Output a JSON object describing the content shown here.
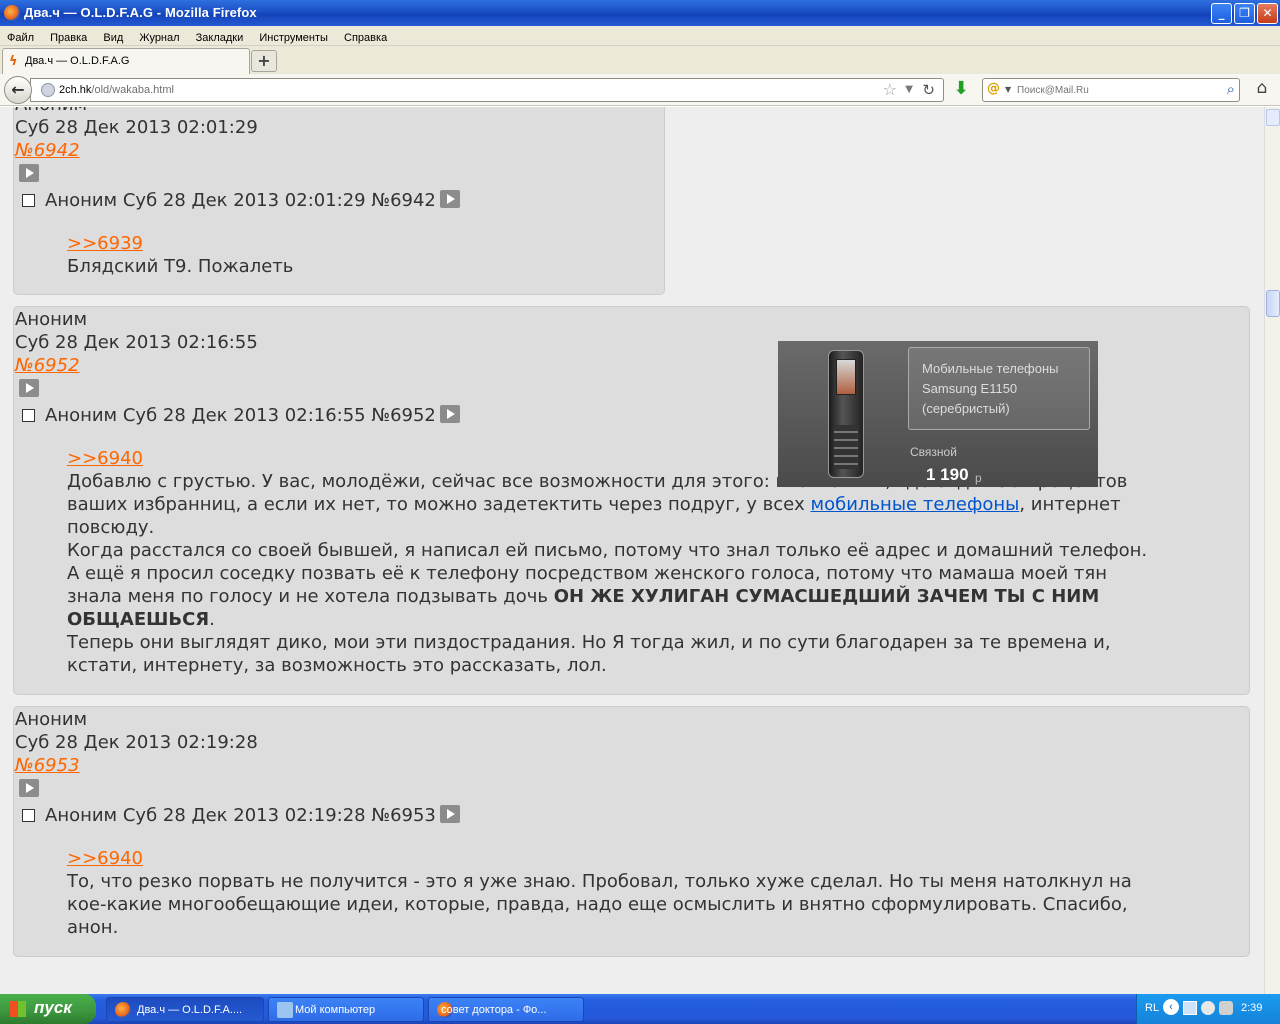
{
  "window": {
    "title": "Два.ч — O.L.D.F.A.G - Mozilla Firefox",
    "minimize_label": "_",
    "maximize_label": "❐",
    "close_label": "✕"
  },
  "menu": [
    "Файл",
    "Правка",
    "Вид",
    "Журнал",
    "Закладки",
    "Инструменты",
    "Справка"
  ],
  "tabs": [
    {
      "label": "Два.ч — O.L.D.F.A.G"
    }
  ],
  "new_tab_label": "+",
  "address": {
    "host": "2ch.hk",
    "path": "/old/wakaba.html"
  },
  "search": {
    "placeholder": "Поиск@Mail.Ru"
  },
  "colors": {
    "link_orange": "#ff6600",
    "post_bg": "#dddddd",
    "page_bg": "#eeeeee",
    "link_blue": "#0055cc"
  },
  "posts": [
    {
      "author": "Аноним",
      "date": "Суб 28 Дек 2013 02:01:29",
      "number": "№6942",
      "header": "Аноним  Суб 28 Дек 2013 02:01:29 №6942",
      "reply_to": ">>6939",
      "lines": [
        "Блядский Т9. Пожалеть"
      ]
    },
    {
      "author": "Аноним",
      "date": "Суб 28 Дек 2013 02:16:55",
      "number": "№6952",
      "header": "Аноним  Суб 28 Дек 2013 02:16:55 №6952",
      "reply_to": ">>6940",
      "line1": "Добавлю с грустью. У вас, молодёжи, сейчас все возможности для этого: вконтактик, где сидит 90 процентов",
      "line2_pre": "ваших избранниц, а если их нет, то можно задетектить через подруг, у всех ",
      "line2_link": "мобильные телефоны",
      "line2_post": ", интернет",
      "line3": "повсюду.",
      "line4": "Когда расстался со своей бывшей, я написал ей письмо, потому что знал только её адрес и домашний телефон.",
      "line5": "А ещё я просил соседку позвать её к телефону посредством женского голоса, потому что мамаша моей тян",
      "line6_pre": "знала меня по голосу и не хотела подзывать дочь ",
      "line6_bold": "ОН ЖЕ ХУЛИГАН СУМАСШЕДШИЙ ЗАЧЕМ ТЫ С НИМ",
      "line7_bold": "ОБЩАЕШЬСЯ",
      "line7_post": ".",
      "line8": "Теперь они выглядят дико, мои эти пиздострадания. Но Я тогда жил, и по сути благодарен за те времена и,",
      "line9": "кстати, интернету, за возможность это рассказать, лол."
    },
    {
      "author": "Аноним",
      "date": "Суб 28 Дек 2013 02:19:28",
      "number": "№6953",
      "header": "Аноним  Суб 28 Дек 2013 02:19:28 №6953",
      "reply_to": ">>6940",
      "lines": [
        "То, что резко порвать не получится - это я уже знаю. Пробовал, только хуже сделал. Но ты меня натолкнул на",
        "кое-какие многообещающие идеи, которые, правда, надо еще осмыслить и внятно сформулировать. Спасибо,",
        "анон."
      ]
    }
  ],
  "ad": {
    "title_line1": "Мобильные телефоны",
    "title_line2": "Samsung E1150",
    "title_line3": "(серебристый)",
    "store": "Связной",
    "price": "1 190",
    "currency": "р"
  },
  "taskbar": {
    "start_label": "пуск",
    "items": [
      "Два.ч — O.L.D.F.A....",
      "Мой компьютер",
      "совет доктора - Фо..."
    ],
    "lang": "RL",
    "clock": "2:39"
  }
}
